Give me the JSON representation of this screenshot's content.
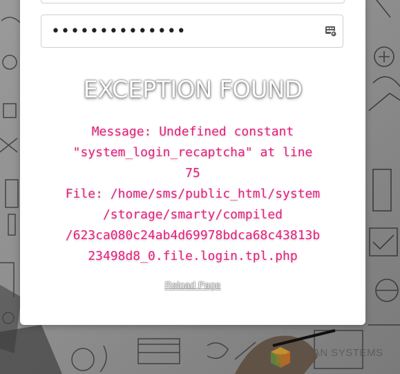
{
  "password_field": {
    "value": "••••••••••••••",
    "toggle_icon": "password-reveal-icon"
  },
  "exception": {
    "title": "EXCEPTION FOUND",
    "message": "Message: Undefined constant\n\"system_login_recaptcha\" at line\n75\nFile: /home/sms/public_html/system\n/storage/smarty/compiled\n/623ca080c24ab4d69978bdca68c43813b\n23498d8_0.file.login.tpl.php",
    "color": "#e8197a"
  },
  "reload": {
    "label": "Reload Page"
  },
  "brand": {
    "name": "TITAN SYSTEMS",
    "logo_icon": "titan-cube-logo"
  }
}
